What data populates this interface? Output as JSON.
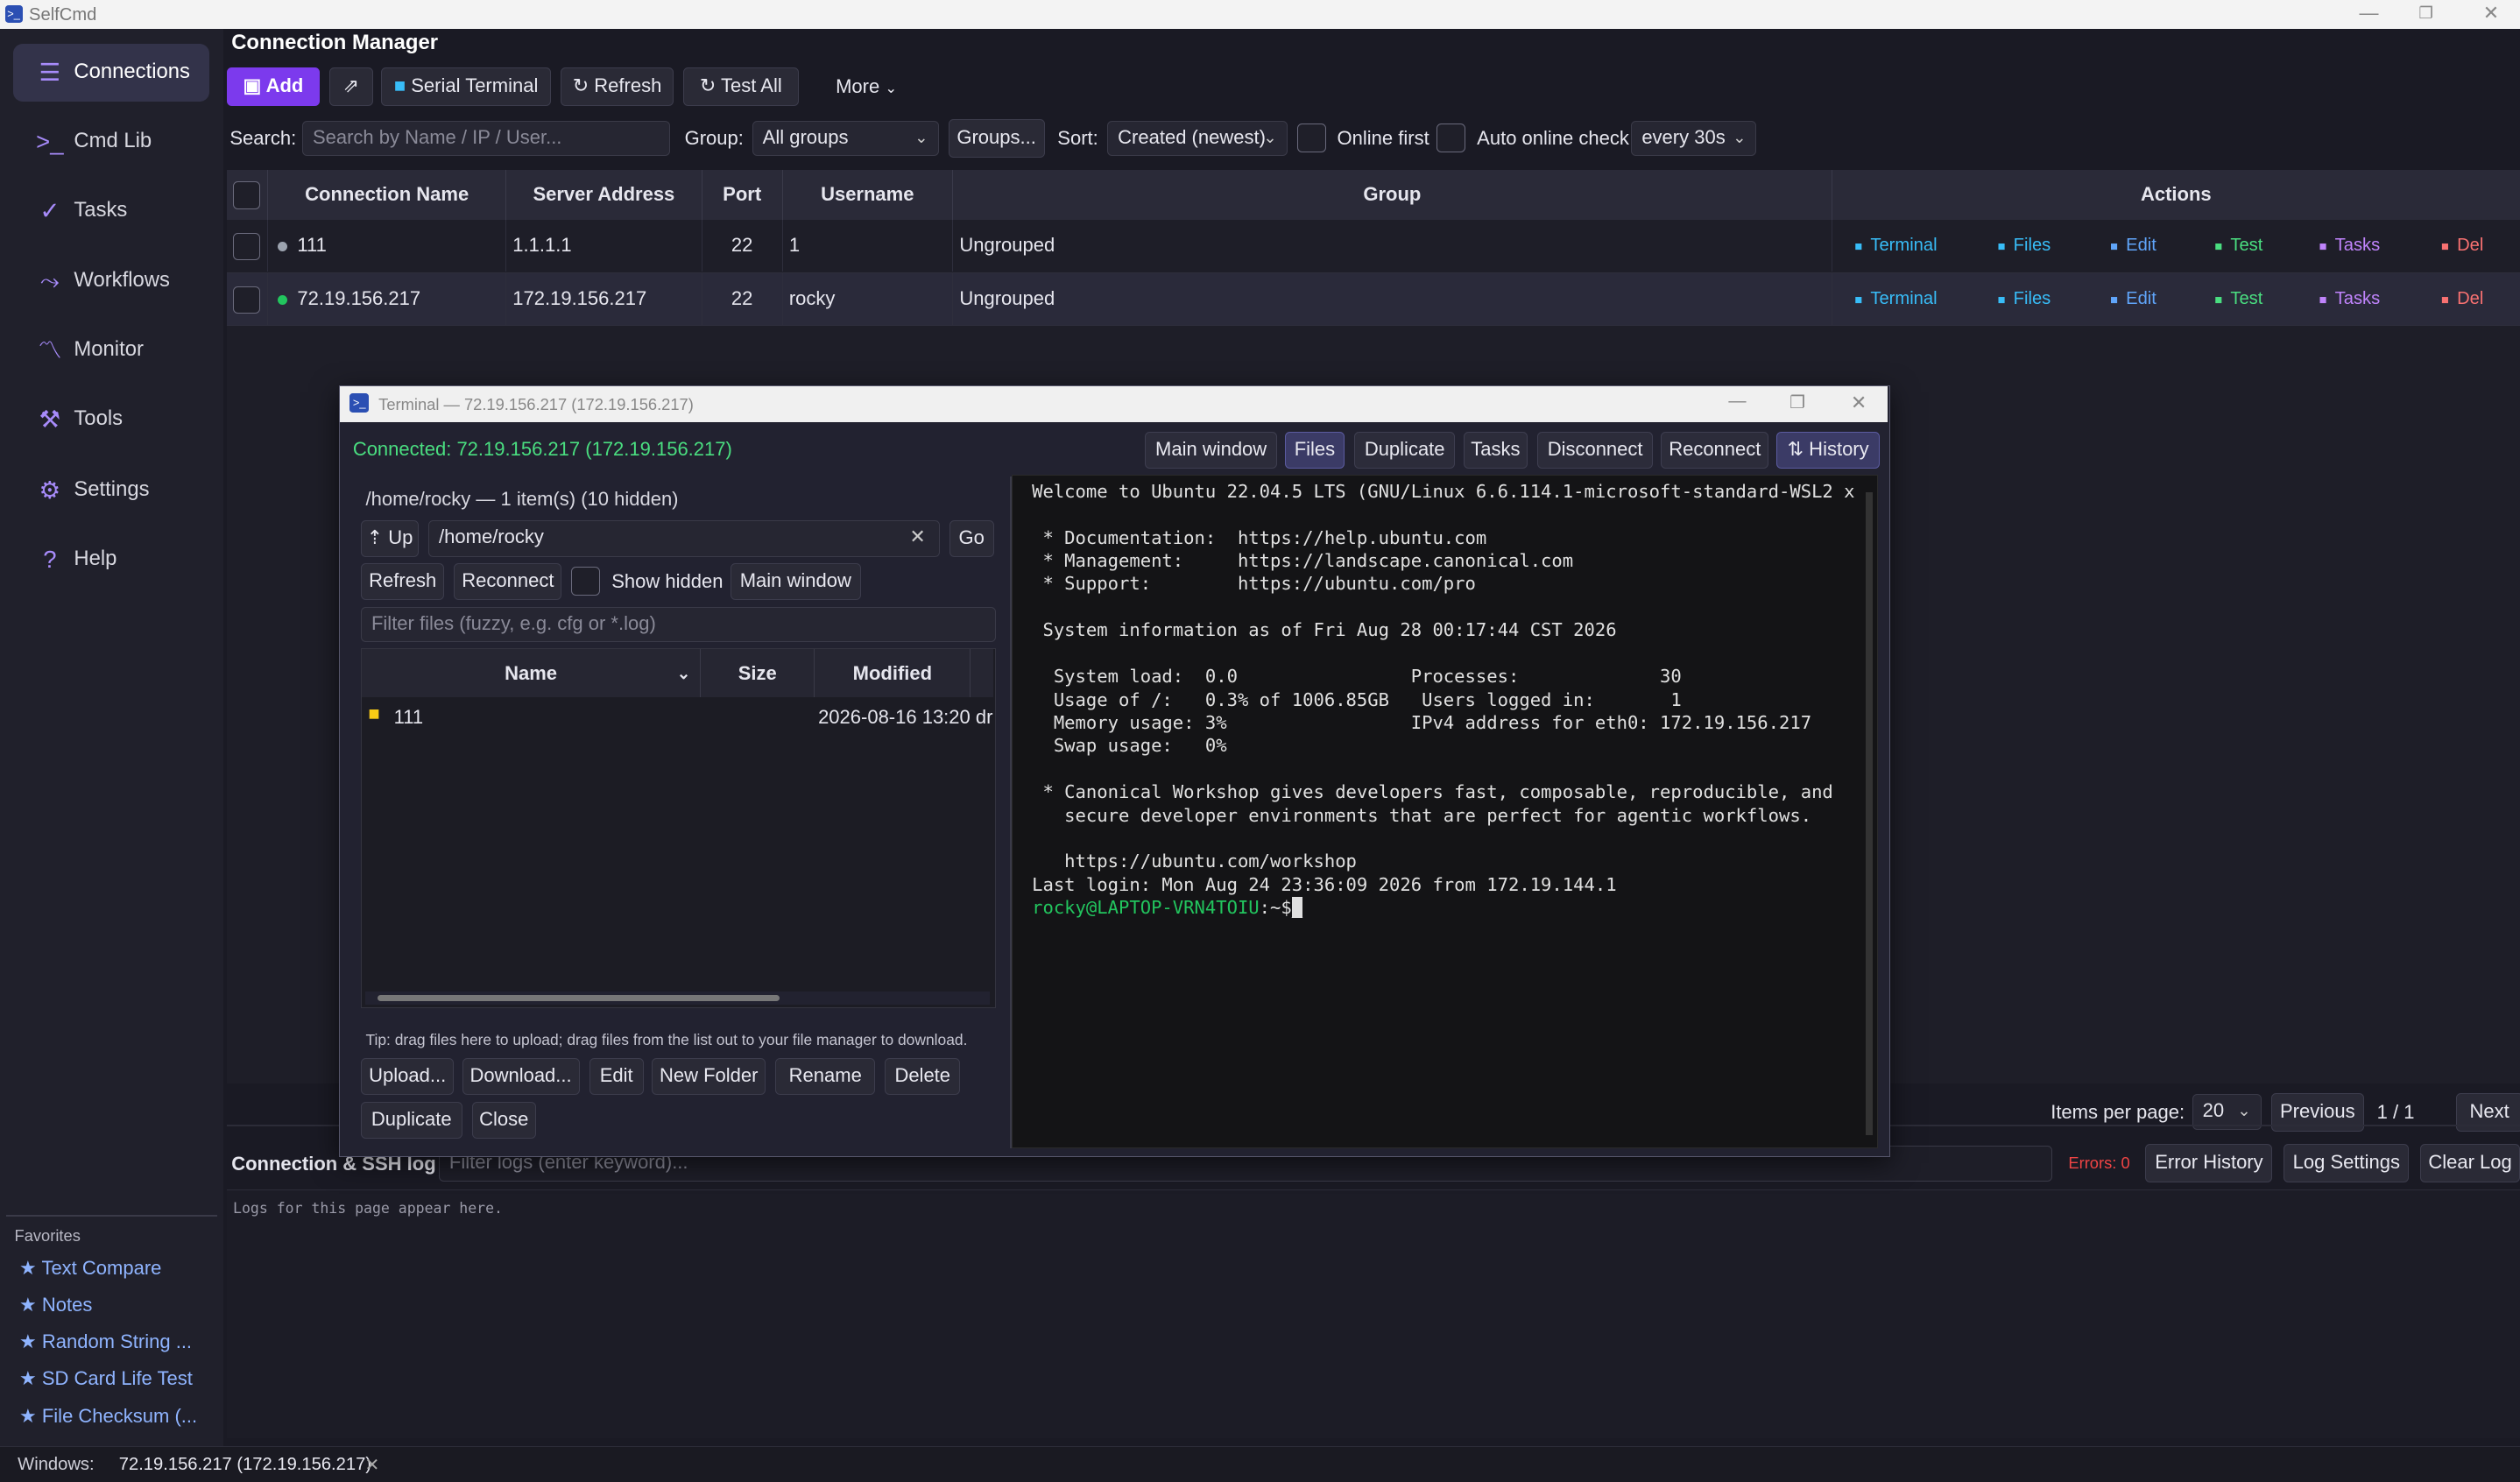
{
  "app": {
    "title": "SelfCmd",
    "icon": ">_"
  },
  "window_controls": {
    "minimize": "—",
    "maximize": "❐",
    "close": "✕"
  },
  "sidebar": {
    "items": [
      {
        "label": "Connections",
        "icon": "connections-icon",
        "glyph": "☰"
      },
      {
        "label": "Cmd Lib",
        "icon": "terminal-icon",
        "glyph": ">_"
      },
      {
        "label": "Tasks",
        "icon": "clipboard-icon",
        "glyph": "✓"
      },
      {
        "label": "Workflows",
        "icon": "workflow-icon",
        "glyph": "⤳"
      },
      {
        "label": "Monitor",
        "icon": "chart-icon",
        "glyph": "〽"
      },
      {
        "label": "Tools",
        "icon": "wrench-icon",
        "glyph": "⚒"
      },
      {
        "label": "Settings",
        "icon": "gear-icon",
        "glyph": "⚙"
      },
      {
        "label": "Help",
        "icon": "help-icon",
        "glyph": "?"
      }
    ],
    "favorites_heading": "Favorites",
    "favorites": [
      "★ Text Compare",
      "★ Notes",
      "★ Random String ...",
      "★ SD Card Life Test",
      "★ File Checksum (..."
    ]
  },
  "main": {
    "title": "Connection Manager",
    "toolbar": {
      "add": "Add",
      "serial": "Serial Terminal",
      "refresh": "Refresh",
      "test_all": "Test All",
      "more": "More"
    },
    "filters": {
      "search_label": "Search:",
      "search_placeholder": "Search by Name / IP / User...",
      "group_label": "Group:",
      "group_value": "All groups",
      "groups_btn": "Groups...",
      "sort_label": "Sort:",
      "sort_value": "Created (newest)",
      "online_first": "Online first",
      "auto_check": "Auto online check",
      "interval": "every 30s"
    },
    "table": {
      "headers": [
        "Connection Name",
        "Server Address",
        "Port",
        "Username",
        "Group",
        "Actions"
      ],
      "rows": [
        {
          "name": "111",
          "address": "1.1.1.1",
          "port": "22",
          "user": "1",
          "group": "Ungrouped",
          "status": "#9ca3af"
        },
        {
          "name": "72.19.156.217",
          "address": "172.19.156.217",
          "port": "22",
          "user": "rocky",
          "group": "Ungrouped",
          "status": "#22c55e"
        }
      ],
      "actions": {
        "terminal": "Terminal",
        "files": "Files",
        "edit": "Edit",
        "test": "Test",
        "tasks": "Tasks",
        "del": "Del"
      }
    },
    "pagination": {
      "label": "Items per page:",
      "value": "20",
      "prev": "Previous",
      "pages": "1 / 1",
      "next": "Next"
    },
    "log": {
      "title": "Connection & SSH log",
      "filter_placeholder": "Filter logs (enter keyword)...",
      "errors": "Errors: 0",
      "error_history": "Error History",
      "settings": "Log Settings",
      "clear": "Clear Log",
      "placeholder": "Logs for this page appear here."
    }
  },
  "statusbar": {
    "label": "Windows:",
    "item": "72.19.156.217 (172.19.156.217)",
    "close": "✕"
  },
  "terminal": {
    "title": "Terminal — 72.19.156.217 (172.19.156.217)",
    "connected": "Connected: 72.19.156.217 (172.19.156.217)",
    "buttons": {
      "main": "Main window",
      "files": "Files",
      "duplicate": "Duplicate",
      "tasks": "Tasks",
      "disconnect": "Disconnect",
      "reconnect": "Reconnect",
      "history": "⇅ History"
    },
    "files": {
      "path_info": "/home/rocky — 1 item(s) (10 hidden)",
      "up": "⇡ Up",
      "path": "/home/rocky",
      "go": "Go",
      "refresh": "Refresh",
      "reconnect": "Reconnect",
      "show_hidden": "Show hidden",
      "main_window": "Main window",
      "filter_placeholder": "Filter files (fuzzy, e.g. cfg or *.log)",
      "headers": [
        "Name",
        "Size",
        "Modified"
      ],
      "rows": [
        {
          "name": "111",
          "size": "",
          "modified": "2026-08-16 13:20",
          "extra": "dr"
        }
      ],
      "tip": "Tip: drag files here to upload; drag files from the list out to your file manager to download.",
      "actions": [
        "Upload...",
        "Download...",
        "Edit",
        "New Folder",
        "Rename",
        "Delete"
      ],
      "actions2": [
        "Duplicate",
        "Close"
      ]
    },
    "lines": [
      "Welcome to Ubuntu 22.04.5 LTS (GNU/Linux 6.6.114.1-microsoft-standard-WSL2 x",
      "",
      " * Documentation:  https://help.ubuntu.com",
      " * Management:     https://landscape.canonical.com",
      " * Support:        https://ubuntu.com/pro",
      "",
      " System information as of Fri Aug 28 00:17:44 CST 2026",
      "",
      "  System load:  0.0                Processes:             30",
      "  Usage of /:   0.3% of 1006.85GB   Users logged in:       1",
      "  Memory usage: 3%                 IPv4 address for eth0: 172.19.156.217",
      "  Swap usage:   0%",
      "",
      " * Canonical Workshop gives developers fast, composable, reproducible, and",
      "   secure developer environments that are perfect for agentic workflows.",
      "",
      "   https://ubuntu.com/workshop",
      "Last login: Mon Aug 24 23:36:09 2026 from 172.19.144.1"
    ],
    "prompt_user": "rocky@LAPTOP-VRN4TOIU",
    "prompt_rest": ":~$"
  }
}
